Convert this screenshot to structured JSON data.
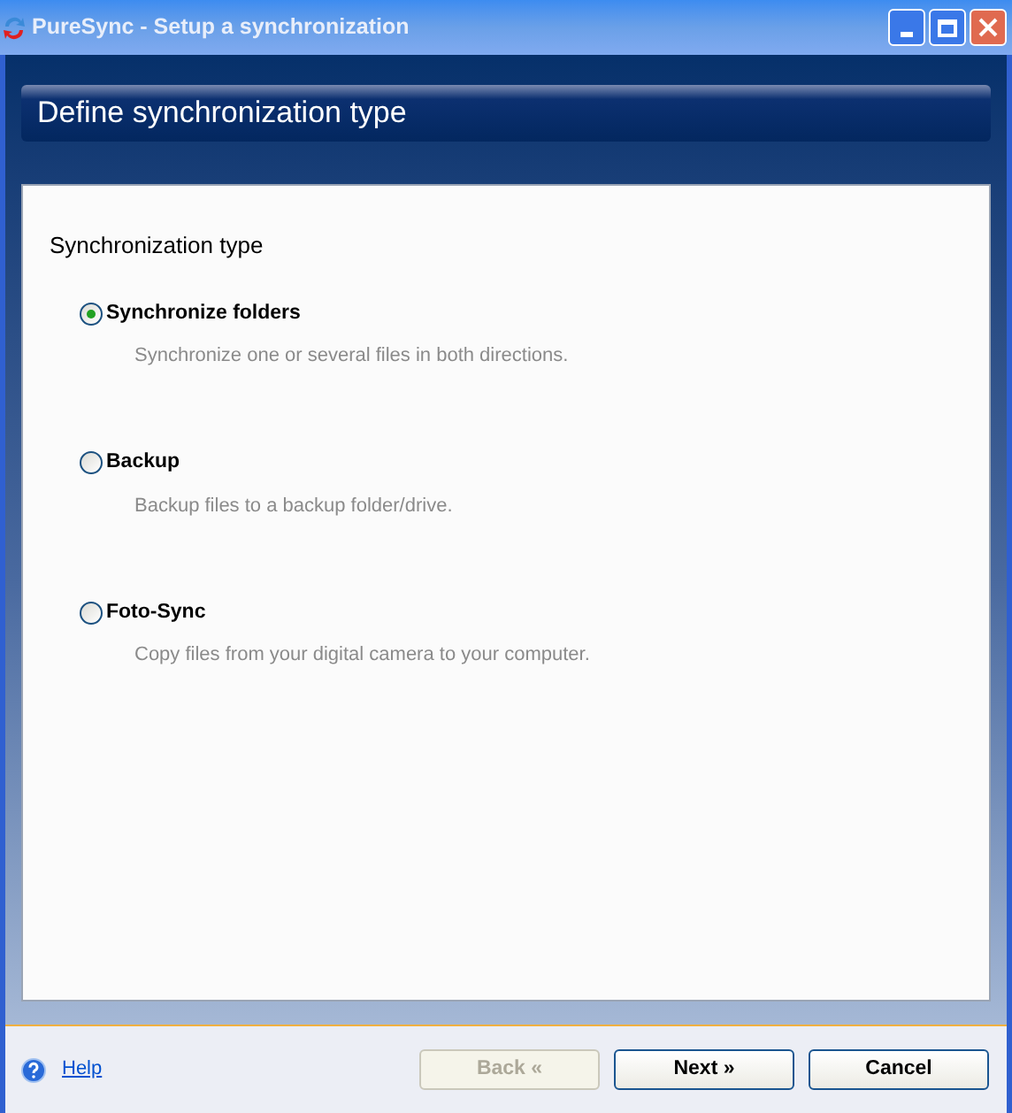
{
  "window": {
    "title": "PureSync - Setup a synchronization"
  },
  "header": {
    "title": "Define synchronization type"
  },
  "panel": {
    "title": "Synchronization type",
    "options": [
      {
        "label": "Synchronize folders",
        "description": "Synchronize one or several files in both directions.",
        "selected": true
      },
      {
        "label": "Backup",
        "description": "Backup files to a backup folder/drive.",
        "selected": false
      },
      {
        "label": "Foto-Sync",
        "description": "Copy files from your digital camera to your computer.",
        "selected": false
      }
    ]
  },
  "footer": {
    "help": "Help",
    "buttons": [
      {
        "label": "Back «",
        "disabled": true
      },
      {
        "label": "Next »",
        "disabled": false
      },
      {
        "label": "Cancel",
        "disabled": false
      }
    ]
  }
}
